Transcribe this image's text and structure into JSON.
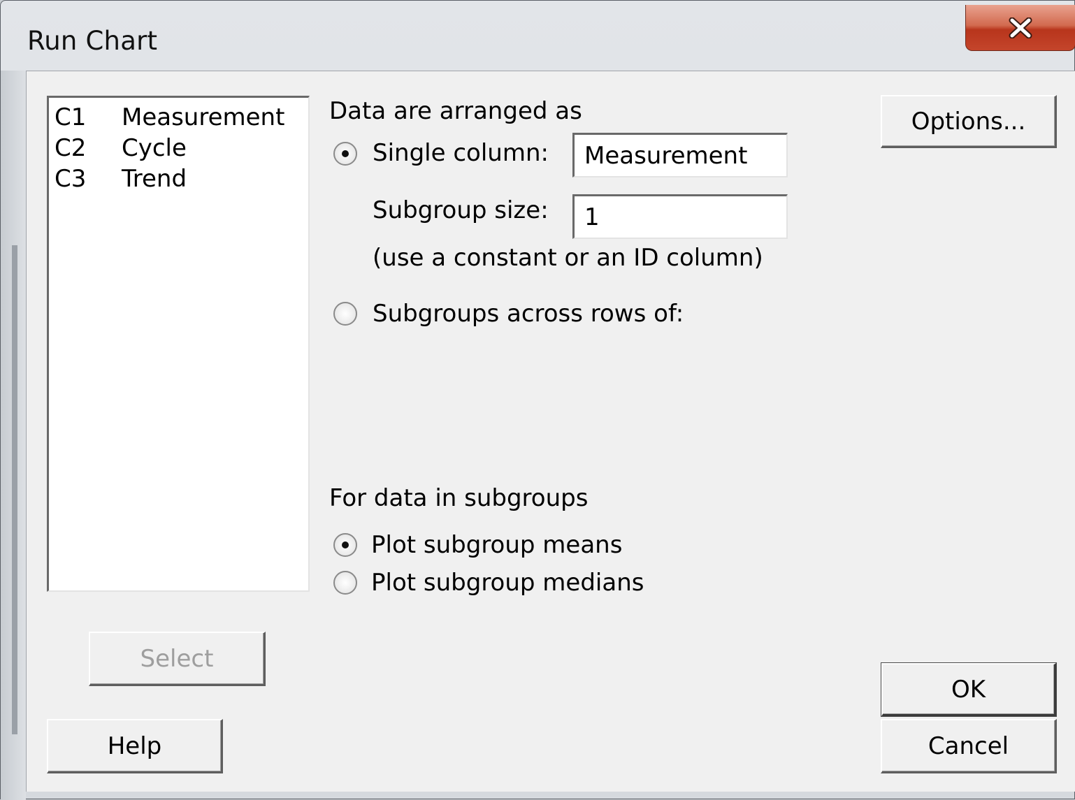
{
  "window": {
    "title": "Run Chart",
    "close_icon": "close-x-icon"
  },
  "variables": [
    {
      "col": "C1",
      "name": "Measurement"
    },
    {
      "col": "C2",
      "name": "Cycle"
    },
    {
      "col": "C3",
      "name": "Trend"
    }
  ],
  "arrangement": {
    "heading": "Data are arranged as",
    "single_column": {
      "label": "Single column:",
      "selected": true,
      "value": "Measurement"
    },
    "subgroup_size": {
      "label": "Subgroup size:",
      "value": "1",
      "hint": "(use a constant or an ID column)"
    },
    "subgroups_across_rows": {
      "label": "Subgroups across rows of:",
      "selected": false
    }
  },
  "subgroups": {
    "heading": "For data in subgroups",
    "plot_means": {
      "label": "Plot subgroup means",
      "selected": true
    },
    "plot_medians": {
      "label": "Plot subgroup medians",
      "selected": false
    }
  },
  "buttons": {
    "options": "Options...",
    "select": "Select",
    "help": "Help",
    "ok": "OK",
    "cancel": "Cancel"
  }
}
